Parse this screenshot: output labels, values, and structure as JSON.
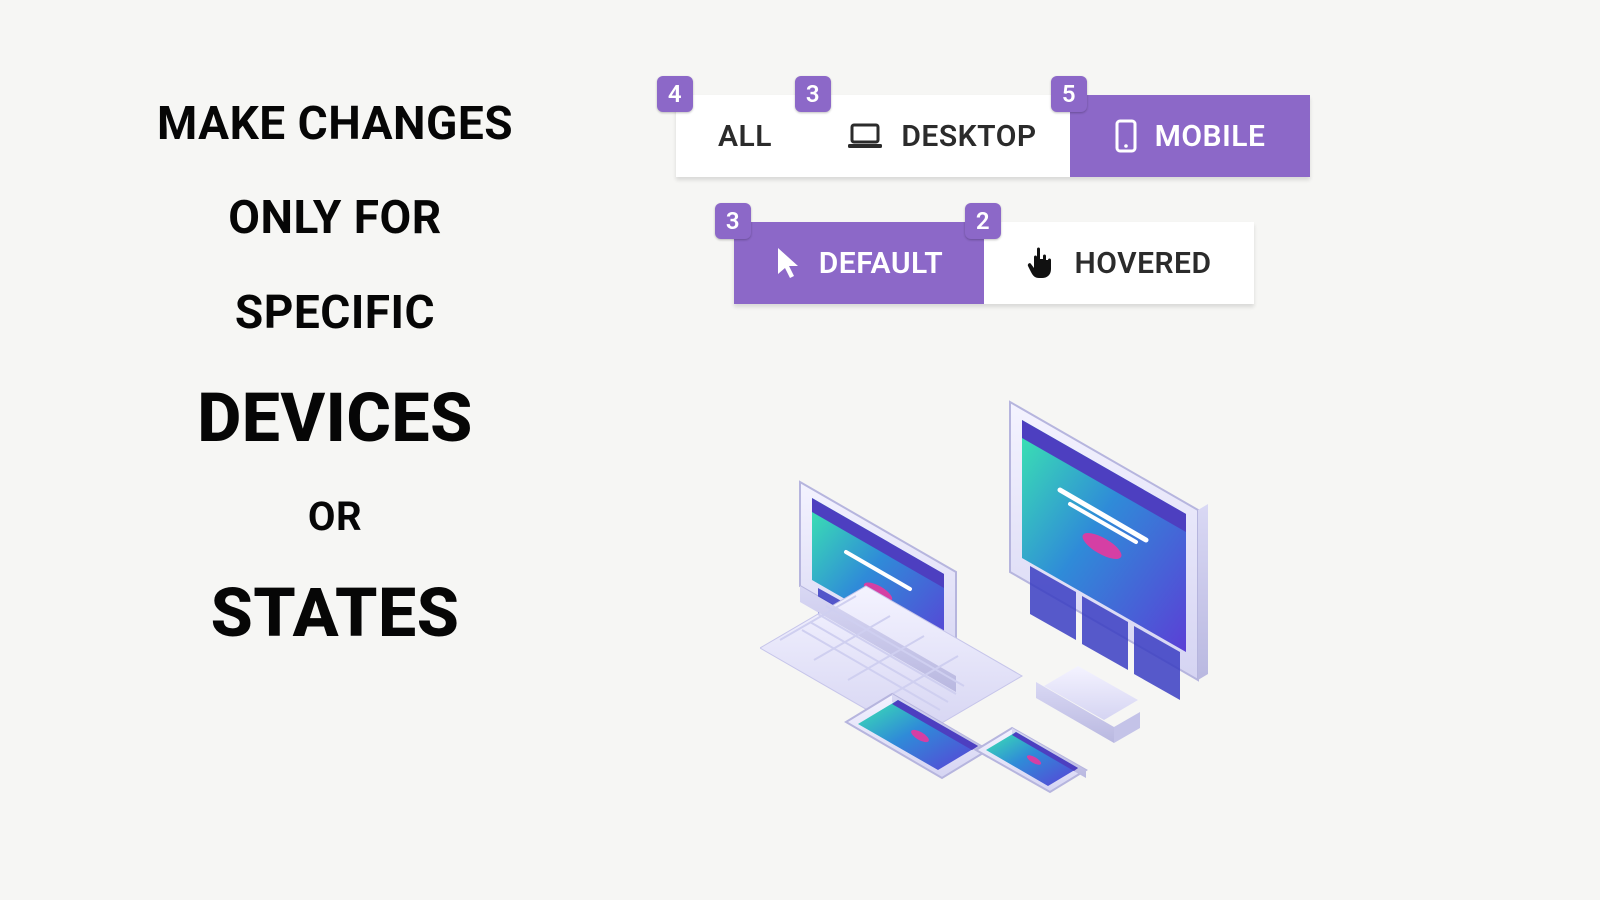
{
  "headline": {
    "line1": "MAKE CHANGES",
    "line2": "ONLY FOR",
    "line3": "SPECIFIC",
    "line4": "DEVICES",
    "line5": "OR",
    "line6": "STATES"
  },
  "deviceTabs": {
    "all": {
      "label": "ALL",
      "badge": "4",
      "active": false
    },
    "desktop": {
      "label": "DESKTOP",
      "badge": "3",
      "active": false
    },
    "mobile": {
      "label": "MOBILE",
      "badge": "5",
      "active": true
    }
  },
  "stateTabs": {
    "default": {
      "label": "DEFAULT",
      "badge": "3",
      "active": true
    },
    "hovered": {
      "label": "HOVERED",
      "badge": "2",
      "active": false
    }
  },
  "colors": {
    "accent": "#8c68c8",
    "text": "#2b2b2b",
    "bg": "#f6f6f4"
  }
}
